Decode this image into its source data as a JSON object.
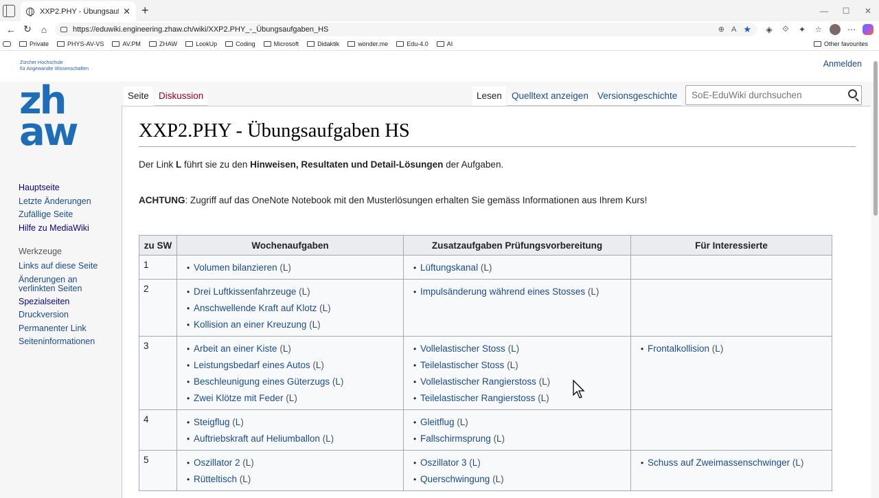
{
  "browser": {
    "tab_title": "XXP2.PHY - Übungsaufgaben HS",
    "url": "https://eduwiki.engineering.zhaw.ch/wiki/XXP2.PHY_-_Übungsaufgaben_HS",
    "favorites": [
      "Private",
      "PHYS-AV-VS",
      "AV.PM",
      "ZHAW",
      "LookUp",
      "Coding",
      "Microsoft",
      "Didaktik",
      "wonder.me",
      "Edu-4.0",
      "AI"
    ],
    "other_favourites": "Other favourites"
  },
  "site": {
    "org_line1": "Zürcher Hochschule",
    "org_line2": "für Angewandte Wissenschaften",
    "logo_text_1": "zh",
    "logo_text_2": "aw",
    "login": "Anmelden"
  },
  "sidebar": {
    "nav": [
      "Hauptseite",
      "Letzte Änderungen",
      "Zufällige Seite",
      "Hilfe zu MediaWiki"
    ],
    "tools_header": "Werkzeuge",
    "tools": [
      "Links auf diese Seite",
      "Änderungen an",
      "verlinkten Seiten",
      "Spezialseiten",
      "Druckversion",
      "Permanenter Link",
      "Seiteninformationen"
    ]
  },
  "tabs": {
    "page": "Seite",
    "discussion": "Diskussion",
    "read": "Lesen",
    "source": "Quelltext anzeigen",
    "history": "Versionsgeschichte"
  },
  "search": {
    "placeholder": "SoE-EduWiki durchsuchen"
  },
  "article": {
    "title": "XXP2.PHY - Übungsaufgaben HS",
    "intro_pre": "Der Link ",
    "intro_L": "L",
    "intro_mid": " führt sie zu den ",
    "intro_bold": "Hinweisen, Resultaten und Detail-Lösungen",
    "intro_post": " der Aufgaben.",
    "warn_bold": "ACHTUNG",
    "warn_text": ": Zugriff auf das OneNote Notebook mit den Musterlösungen erhalten Sie gemäss Informationen aus Ihrem Kurs!",
    "table_headers": [
      "zu SW",
      "Wochenaufgaben",
      "Zusatzaufgaben Prüfungsvorbereitung",
      "Für Interessierte"
    ],
    "link_marker": "L",
    "rows": [
      {
        "sw": "1",
        "weekly": [
          "Volumen bilanzieren"
        ],
        "extra": [
          "Lüftungskanal"
        ],
        "interest": []
      },
      {
        "sw": "2",
        "weekly": [
          "Drei Luftkissenfahrzeuge",
          "Anschwellende Kraft auf Klotz",
          "Kollision an einer Kreuzung"
        ],
        "extra": [
          "Impulsänderung während eines Stosses"
        ],
        "interest": []
      },
      {
        "sw": "3",
        "weekly": [
          "Arbeit an einer Kiste",
          "Leistungsbedarf eines Autos",
          "Beschleunigung eines Güterzugs",
          "Zwei Klötze mit Feder"
        ],
        "extra": [
          "Vollelastischer Stoss",
          "Teilelastischer Stoss",
          "Vollelastischer Rangierstoss",
          "Teilelastischer Rangierstoss"
        ],
        "interest": [
          "Frontalkollision"
        ]
      },
      {
        "sw": "4",
        "weekly": [
          "Steigflug",
          "Auftriebskraft auf Heliumballon"
        ],
        "extra": [
          "Gleitflug",
          "Fallschirmsprung"
        ],
        "interest": []
      },
      {
        "sw": "5",
        "weekly": [
          "Oszillator 2",
          "Rütteltisch"
        ],
        "extra": [
          "Oszillator 3",
          "Querschwingung"
        ],
        "interest": [
          "Schuss auf Zweimassenschwinger"
        ]
      }
    ]
  }
}
